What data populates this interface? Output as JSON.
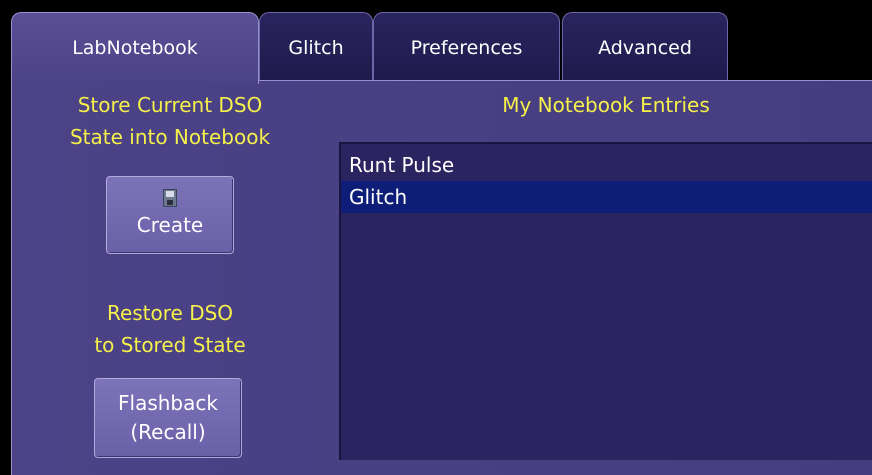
{
  "tabs": [
    {
      "label": "LabNotebook",
      "active": true
    },
    {
      "label": "Glitch",
      "active": false
    },
    {
      "label": "Preferences",
      "active": false
    },
    {
      "label": "Advanced",
      "active": false
    }
  ],
  "left": {
    "store_heading_line1": "Store Current DSO",
    "store_heading_line2": "State into Notebook",
    "create_button_label": "Create",
    "restore_heading_line1": "Restore DSO",
    "restore_heading_line2": "to Stored State",
    "flashback_label_line1": "Flashback",
    "flashback_label_line2": "(Recall)"
  },
  "right": {
    "heading": "My Notebook Entries",
    "entries": [
      {
        "label": "Runt Pulse",
        "selected": false
      },
      {
        "label": "Glitch",
        "selected": true
      }
    ]
  },
  "colors": {
    "heading_yellow": "#f5f04a",
    "panel_purple": "#4c4287",
    "selection_blue": "#0e1e78"
  }
}
